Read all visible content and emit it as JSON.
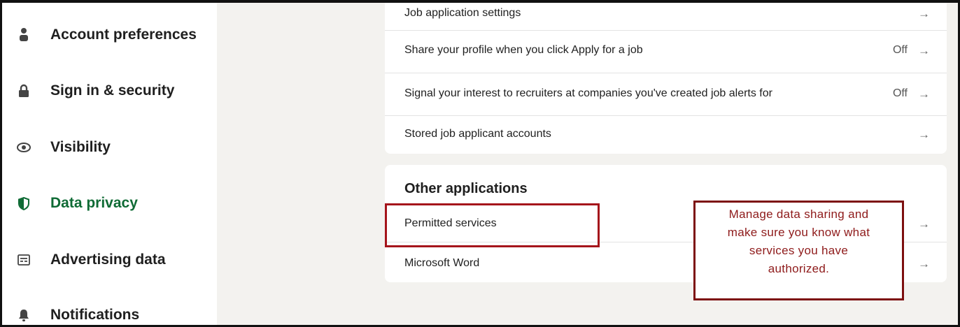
{
  "sidebar": {
    "items": [
      {
        "label": "Account preferences",
        "icon": "person-icon"
      },
      {
        "label": "Sign in & security",
        "icon": "lock-icon"
      },
      {
        "label": "Visibility",
        "icon": "eye-icon"
      },
      {
        "label": "Data privacy",
        "icon": "shield-icon",
        "active": true
      },
      {
        "label": "Advertising data",
        "icon": "newspaper-icon"
      },
      {
        "label": "Notifications",
        "icon": "bell-icon"
      }
    ]
  },
  "job_card": {
    "rows": [
      {
        "label": "Job application settings",
        "status": "",
        "arrow": "→"
      },
      {
        "label": "Share your profile when you click Apply for a job",
        "status": "Off",
        "arrow": "→"
      },
      {
        "label": "Signal your interest to recruiters at companies you've created job alerts for",
        "status": "Off",
        "arrow": "→"
      },
      {
        "label": "Stored job applicant accounts",
        "status": "",
        "arrow": "→"
      }
    ]
  },
  "other_card": {
    "title": "Other applications",
    "rows": [
      {
        "label": "Permitted services",
        "arrow": "→"
      },
      {
        "label": "Microsoft Word",
        "arrow": "→"
      }
    ]
  },
  "callout": {
    "lines": [
      "Manage data sharing and",
      "make sure you know what",
      "services you have",
      "authorized."
    ]
  },
  "colors": {
    "active": "#0f6b35",
    "annotation": "#a5141b",
    "background": "#f3f2ef"
  }
}
